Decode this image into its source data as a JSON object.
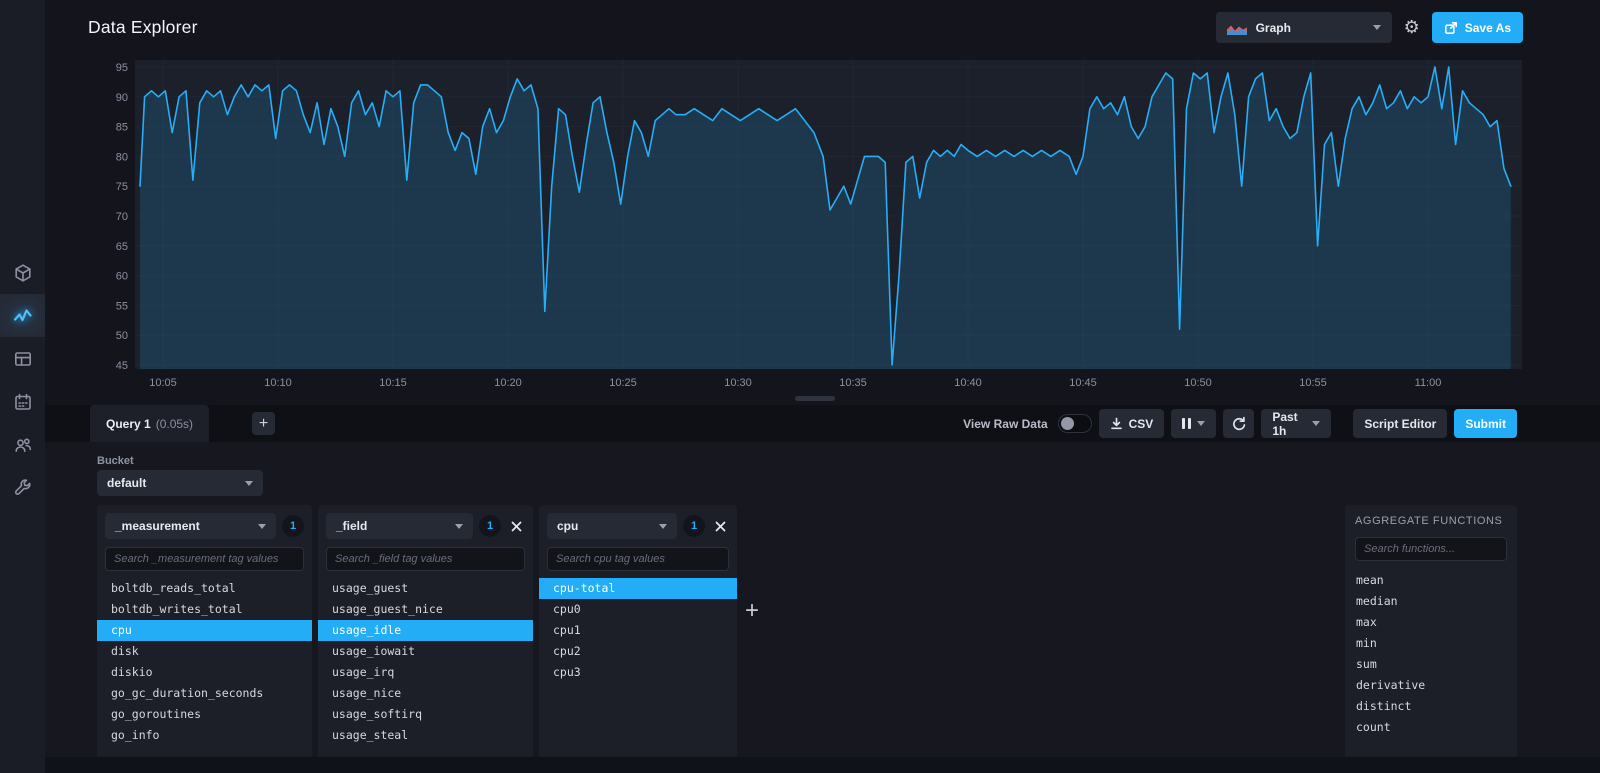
{
  "header": {
    "title": "Data Explorer",
    "view_type_label": "Graph",
    "save_as_label": "Save As"
  },
  "sidebar": {
    "items": [
      {
        "name": "home",
        "active": false
      },
      {
        "name": "data-explorer",
        "active": true
      },
      {
        "name": "dashboards",
        "active": false
      },
      {
        "name": "tasks",
        "active": false
      },
      {
        "name": "organization",
        "active": false
      },
      {
        "name": "settings",
        "active": false
      }
    ]
  },
  "chart_data": {
    "type": "area",
    "title": "",
    "xlabel": "",
    "ylabel": "",
    "legend": "none",
    "grid": true,
    "y_ticks": [
      45,
      50,
      55,
      60,
      65,
      70,
      75,
      80,
      85,
      90,
      95
    ],
    "y_range": [
      43.8,
      96.8
    ],
    "x_ticks": [
      {
        "min": 5,
        "label": "10:05"
      },
      {
        "min": 10,
        "label": "10:10"
      },
      {
        "min": 15,
        "label": "10:15"
      },
      {
        "min": 20,
        "label": "10:20"
      },
      {
        "min": 25,
        "label": "10:25"
      },
      {
        "min": 30,
        "label": "10:30"
      },
      {
        "min": 35,
        "label": "10:35"
      },
      {
        "min": 40,
        "label": "10:40"
      },
      {
        "min": 45,
        "label": "10:45"
      },
      {
        "min": 50,
        "label": "10:50"
      },
      {
        "min": 55,
        "label": "10:55"
      },
      {
        "min": 60,
        "label": "11:00"
      }
    ],
    "series": [
      {
        "name": "usage_idle",
        "line_color": "#27aef7",
        "fill_color": "rgba(34,173,246,0.17)",
        "points": [
          [
            4,
            75
          ],
          [
            4.2,
            90
          ],
          [
            4.5,
            91
          ],
          [
            4.8,
            90
          ],
          [
            5.1,
            91
          ],
          [
            5.4,
            84
          ],
          [
            5.7,
            90
          ],
          [
            6,
            91
          ],
          [
            6.3,
            76
          ],
          [
            6.6,
            89
          ],
          [
            6.9,
            91
          ],
          [
            7.2,
            90
          ],
          [
            7.5,
            91
          ],
          [
            7.8,
            87
          ],
          [
            8.1,
            90
          ],
          [
            8.4,
            92
          ],
          [
            8.7,
            90
          ],
          [
            9,
            92
          ],
          [
            9.3,
            91
          ],
          [
            9.6,
            92
          ],
          [
            9.9,
            83
          ],
          [
            10.2,
            91
          ],
          [
            10.5,
            92
          ],
          [
            10.8,
            91
          ],
          [
            11.1,
            87
          ],
          [
            11.4,
            84
          ],
          [
            11.7,
            89
          ],
          [
            12,
            82
          ],
          [
            12.3,
            88
          ],
          [
            12.6,
            85
          ],
          [
            12.9,
            80
          ],
          [
            13.2,
            89
          ],
          [
            13.5,
            91
          ],
          [
            13.8,
            87
          ],
          [
            14.1,
            89
          ],
          [
            14.4,
            85
          ],
          [
            14.7,
            91
          ],
          [
            15,
            90
          ],
          [
            15.3,
            91
          ],
          [
            15.6,
            76
          ],
          [
            15.9,
            89
          ],
          [
            16.2,
            92
          ],
          [
            16.5,
            92
          ],
          [
            16.8,
            91
          ],
          [
            17.1,
            90
          ],
          [
            17.4,
            84
          ],
          [
            17.7,
            81
          ],
          [
            18,
            84
          ],
          [
            18.3,
            83
          ],
          [
            18.6,
            77
          ],
          [
            18.9,
            85
          ],
          [
            19.2,
            88
          ],
          [
            19.5,
            84
          ],
          [
            19.8,
            86
          ],
          [
            20.1,
            90
          ],
          [
            20.4,
            93
          ],
          [
            20.7,
            91
          ],
          [
            21,
            92
          ],
          [
            21.3,
            88
          ],
          [
            21.6,
            54
          ],
          [
            21.9,
            75
          ],
          [
            22.2,
            88
          ],
          [
            22.5,
            87
          ],
          [
            22.8,
            80
          ],
          [
            23.1,
            74
          ],
          [
            23.4,
            82
          ],
          [
            23.7,
            89
          ],
          [
            24,
            90
          ],
          [
            24.3,
            84
          ],
          [
            24.6,
            79
          ],
          [
            24.9,
            72
          ],
          [
            25.2,
            80
          ],
          [
            25.5,
            86
          ],
          [
            25.8,
            84
          ],
          [
            26.1,
            80
          ],
          [
            26.4,
            86
          ],
          [
            26.7,
            87
          ],
          [
            27,
            88
          ],
          [
            27.3,
            87
          ],
          [
            27.7,
            87
          ],
          [
            28.1,
            88
          ],
          [
            28.5,
            87
          ],
          [
            28.9,
            86
          ],
          [
            29.3,
            88
          ],
          [
            29.7,
            87
          ],
          [
            30.1,
            86
          ],
          [
            30.5,
            87
          ],
          [
            30.9,
            88
          ],
          [
            31.3,
            87
          ],
          [
            31.7,
            86
          ],
          [
            32.1,
            87
          ],
          [
            32.5,
            88
          ],
          [
            32.9,
            86
          ],
          [
            33.3,
            84
          ],
          [
            33.7,
            80
          ],
          [
            34,
            71
          ],
          [
            34.3,
            73
          ],
          [
            34.6,
            75
          ],
          [
            34.9,
            72
          ],
          [
            35.2,
            76
          ],
          [
            35.5,
            80
          ],
          [
            35.8,
            80
          ],
          [
            36.1,
            80
          ],
          [
            36.4,
            79
          ],
          [
            36.7,
            45
          ],
          [
            37,
            60
          ],
          [
            37.3,
            79
          ],
          [
            37.6,
            80
          ],
          [
            37.9,
            73
          ],
          [
            38.2,
            79
          ],
          [
            38.5,
            81
          ],
          [
            38.8,
            80
          ],
          [
            39.1,
            81
          ],
          [
            39.4,
            80
          ],
          [
            39.7,
            82
          ],
          [
            40,
            81
          ],
          [
            40.4,
            80
          ],
          [
            40.8,
            81
          ],
          [
            41.2,
            80
          ],
          [
            41.6,
            81
          ],
          [
            42,
            80
          ],
          [
            42.4,
            81
          ],
          [
            42.8,
            80
          ],
          [
            43.2,
            81
          ],
          [
            43.6,
            80
          ],
          [
            44,
            81
          ],
          [
            44.4,
            80
          ],
          [
            44.7,
            77
          ],
          [
            45,
            80
          ],
          [
            45.3,
            88
          ],
          [
            45.6,
            90
          ],
          [
            45.9,
            88
          ],
          [
            46.2,
            89
          ],
          [
            46.5,
            87
          ],
          [
            46.8,
            90
          ],
          [
            47.1,
            85
          ],
          [
            47.4,
            83
          ],
          [
            47.7,
            85
          ],
          [
            48,
            90
          ],
          [
            48.3,
            92
          ],
          [
            48.6,
            94
          ],
          [
            48.9,
            93
          ],
          [
            49.2,
            51
          ],
          [
            49.5,
            88
          ],
          [
            49.8,
            94
          ],
          [
            50.1,
            93
          ],
          [
            50.4,
            94
          ],
          [
            50.7,
            84
          ],
          [
            51,
            90
          ],
          [
            51.3,
            94
          ],
          [
            51.6,
            87
          ],
          [
            51.9,
            75
          ],
          [
            52.2,
            90
          ],
          [
            52.5,
            93
          ],
          [
            52.8,
            94
          ],
          [
            53.1,
            86
          ],
          [
            53.4,
            88
          ],
          [
            53.7,
            85
          ],
          [
            54,
            83
          ],
          [
            54.3,
            84
          ],
          [
            54.6,
            90
          ],
          [
            54.9,
            94
          ],
          [
            55.2,
            65
          ],
          [
            55.5,
            82
          ],
          [
            55.8,
            84
          ],
          [
            56.1,
            75
          ],
          [
            56.4,
            83
          ],
          [
            56.7,
            88
          ],
          [
            57,
            90
          ],
          [
            57.3,
            87
          ],
          [
            57.6,
            89
          ],
          [
            57.9,
            92
          ],
          [
            58.2,
            88
          ],
          [
            58.5,
            89
          ],
          [
            58.8,
            91
          ],
          [
            59.1,
            88
          ],
          [
            59.4,
            90
          ],
          [
            59.7,
            89
          ],
          [
            60,
            90
          ],
          [
            60.3,
            95
          ],
          [
            60.6,
            88
          ],
          [
            60.9,
            95
          ],
          [
            61.2,
            82
          ],
          [
            61.5,
            91
          ],
          [
            61.8,
            89
          ],
          [
            62.1,
            88
          ],
          [
            62.4,
            87
          ],
          [
            62.7,
            85
          ],
          [
            63,
            86
          ],
          [
            63.3,
            78
          ],
          [
            63.6,
            75
          ]
        ]
      }
    ]
  },
  "query_panel": {
    "tab": {
      "name": "Query 1",
      "duration": "(0.05s)"
    },
    "add_query_label": "+",
    "controls": {
      "view_raw_label": "View Raw Data",
      "toggle_state": "off",
      "csv_label": "CSV",
      "time_range_label": "Past 1h",
      "script_editor_label": "Script Editor",
      "submit_label": "Submit"
    },
    "bucket": {
      "label": "Bucket",
      "selected": "default"
    },
    "tag_cards": [
      {
        "key": "_measurement",
        "count": "1",
        "closable": false,
        "search_placeholder": "Search _measurement tag values",
        "selected": "cpu",
        "items": [
          "boltdb_reads_total",
          "boltdb_writes_total",
          "cpu",
          "disk",
          "diskio",
          "go_gc_duration_seconds",
          "go_goroutines",
          "go_info"
        ]
      },
      {
        "key": "_field",
        "count": "1",
        "closable": true,
        "search_placeholder": "Search _field tag values",
        "selected": "usage_idle",
        "items": [
          "usage_guest",
          "usage_guest_nice",
          "usage_idle",
          "usage_iowait",
          "usage_irq",
          "usage_nice",
          "usage_softirq",
          "usage_steal"
        ]
      },
      {
        "key": "cpu",
        "count": "1",
        "closable": true,
        "search_placeholder": "Search cpu tag values",
        "selected": "cpu-total",
        "items": [
          "cpu-total",
          "cpu0",
          "cpu1",
          "cpu2",
          "cpu3"
        ]
      }
    ],
    "add_tag_label": "+",
    "aggregate": {
      "title": "AGGREGATE FUNCTIONS",
      "search_placeholder": "Search functions...",
      "items": [
        "mean",
        "median",
        "max",
        "min",
        "sum",
        "derivative",
        "distinct",
        "count"
      ]
    }
  },
  "annotation": {
    "shape": "ellipse",
    "target": "Script Editor button",
    "color": "#c52a17"
  }
}
